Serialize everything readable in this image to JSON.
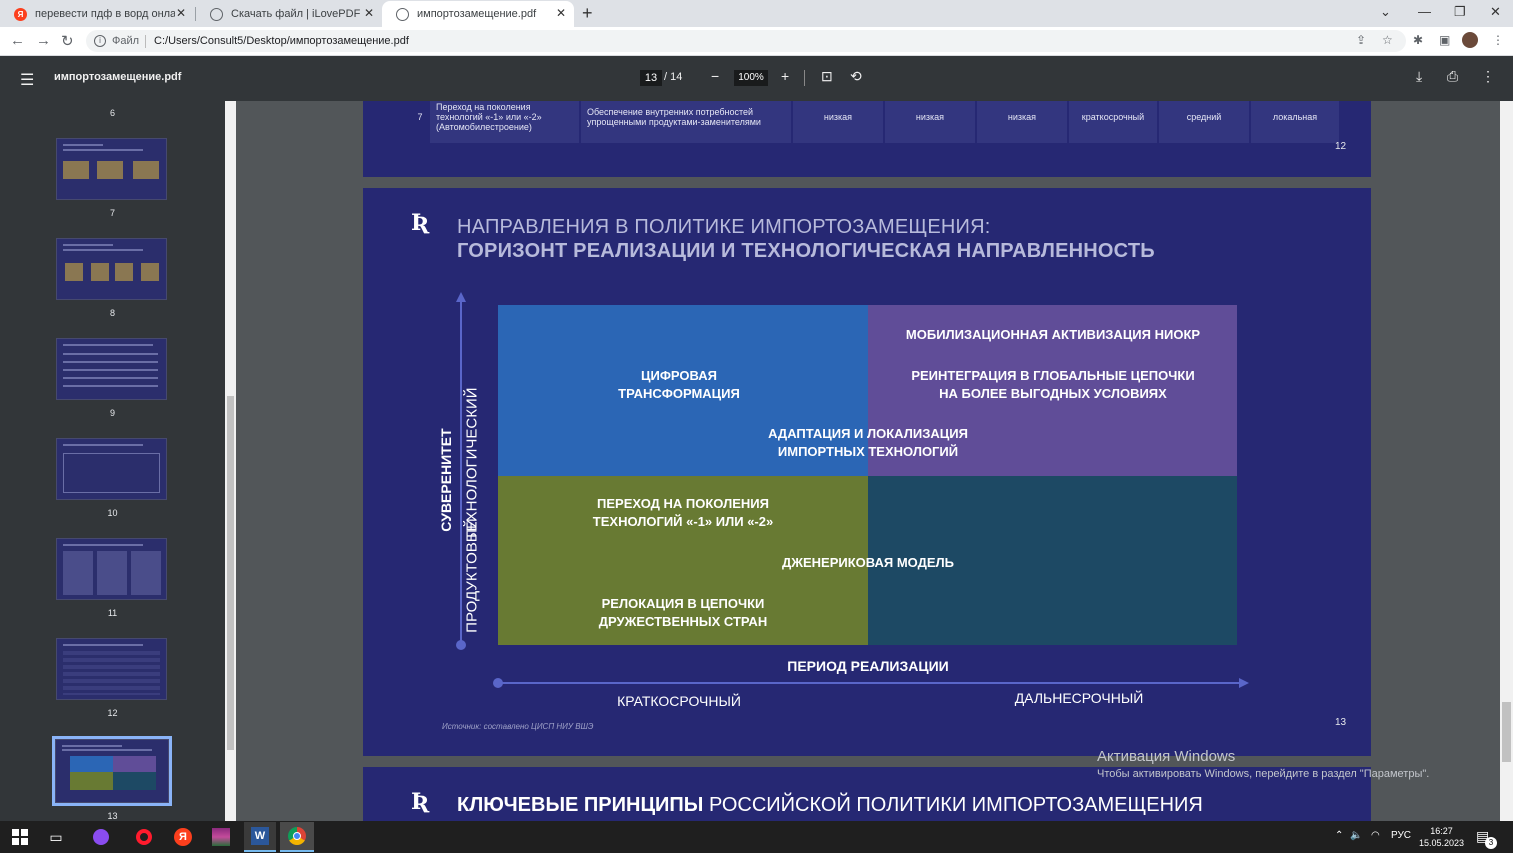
{
  "browser": {
    "tabs": [
      {
        "title": "перевести пдф в ворд онлайн б",
        "icon": "yandex-icon",
        "color": "#fc3f1d"
      },
      {
        "title": "Скачать файл | iLovePDF",
        "icon": "globe-icon"
      },
      {
        "title": "импортозамещение.pdf",
        "icon": "globe-icon"
      }
    ],
    "address": {
      "scheme_label": "Файл",
      "url": "C:/Users/Consult5/Desktop/импортозамещение.pdf"
    }
  },
  "pdf_toolbar": {
    "title": "импортозамещение.pdf",
    "current_page": "13",
    "total_pages": "/ 14",
    "zoom": "100%"
  },
  "sidebar": {
    "pages": [
      "6",
      "7",
      "8",
      "9",
      "10",
      "11",
      "12",
      "13"
    ],
    "selected": "13"
  },
  "page12": {
    "row_number": "7",
    "col1": "Переход на поколения технологий «-1» или «-2» (Автомобилестроение)",
    "col2": "Обеспечение внутренних потребностей упрощенными продуктами-заменителями",
    "col3": "низкая",
    "col4": "низкая",
    "col5": "низкая",
    "col6": "краткосрочный",
    "col7": "средний",
    "col8": "локальная",
    "page_number": "12"
  },
  "page13": {
    "title_light": "НАПРАВЛЕНИЯ В ПОЛИТИКЕ ИМПОРТОЗАМЕЩЕНИЯ:",
    "title_bold": "ГОРИЗОНТ РЕАЛИЗАЦИИ И ТЕХНОЛОГИЧЕСКАЯ НАПРАВЛЕННОСТЬ",
    "y_axis_title": "СУВЕРЕНИТЕТ",
    "y_top": "ТЕХНОЛОГИЧЕСКИЙ",
    "y_bottom": "ПРОДУКТОВЫЙ",
    "x_axis_title": "ПЕРИОД РЕАЛИЗАЦИИ",
    "x_left": "КРАТКОСРОЧНЫЙ",
    "x_right": "ДАЛЬНЕСРОЧНЫЙ",
    "items": {
      "digital_1": "ЦИФРОВАЯ",
      "digital_2": "ТРАНСФОРМАЦИЯ",
      "mobil": "МОБИЛИЗАЦИОННАЯ АКТИВИЗАЦИЯ НИОКР",
      "reint_1": "РЕИНТЕГРАЦИЯ В ГЛОБАЛЬНЫЕ ЦЕПОЧКИ",
      "reint_2": "НА БОЛЕЕ ВЫГОДНЫХ УСЛОВИЯХ",
      "adapt_1": "АДАПТАЦИЯ И ЛОКАЛИЗАЦИЯ",
      "adapt_2": "ИМПОРТНЫХ ТЕХНОЛОГИЙ",
      "trans_1": "ПЕРЕХОД НА ПОКОЛЕНИЯ",
      "trans_2": "ТЕХНОЛОГИЙ «-1» ИЛИ «-2»",
      "generic": "ДЖЕНЕРИКОВАЯ МОДЕЛЬ",
      "reloc_1": "РЕЛОКАЦИЯ В ЦЕПОЧКИ",
      "reloc_2": "ДРУЖЕСТВЕННЫХ СТРАН"
    },
    "quadrant_colors": {
      "top_left": "#2b66b5",
      "top_right": "#604d98",
      "bottom_left": "#687a33",
      "bottom_right": "#1d4964"
    },
    "source": "Источник: составлено ЦИСП НИУ ВШЭ",
    "page_number": "13"
  },
  "page14": {
    "title_bold": "КЛЮЧЕВЫЕ ПРИНЦИПЫ",
    "title_light": " РОССИЙСКОЙ ПОЛИТИКИ ИМПОРТОЗАМЕЩЕНИЯ"
  },
  "watermark": {
    "line1": "Активация Windows",
    "line2": "Чтобы активировать Windows, перейдите в раздел \"Параметры\"."
  },
  "taskbar": {
    "lang": "РУС",
    "time": "16:27",
    "date": "15.05.2023",
    "notifications": "3"
  }
}
